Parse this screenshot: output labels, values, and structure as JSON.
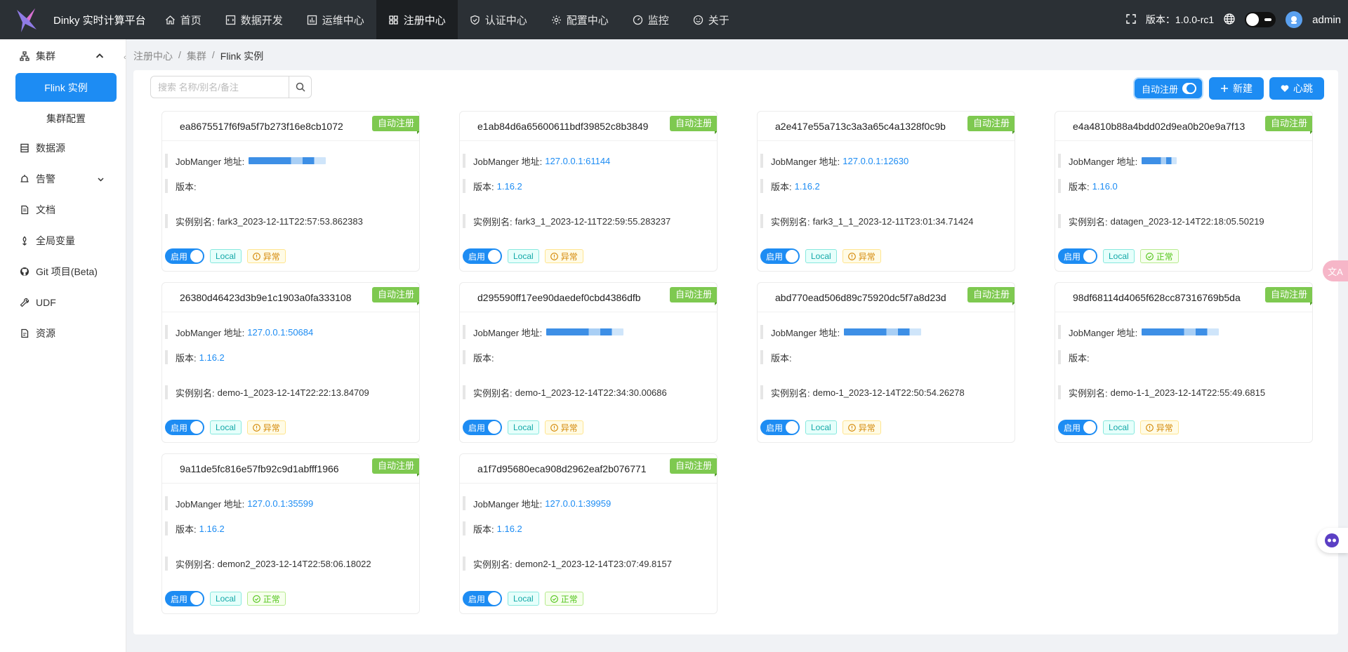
{
  "app": {
    "title": "Dinky 实时计算平台"
  },
  "nav": [
    {
      "label": "首页",
      "icon": "home-icon"
    },
    {
      "label": "数据开发",
      "icon": "code-icon"
    },
    {
      "label": "运维中心",
      "icon": "dashboard-icon"
    },
    {
      "label": "注册中心",
      "icon": "appstore-icon",
      "active": true
    },
    {
      "label": "认证中心",
      "icon": "shield-icon"
    },
    {
      "label": "配置中心",
      "icon": "settings-icon"
    },
    {
      "label": "监控",
      "icon": "gauge-icon"
    },
    {
      "label": "关于",
      "icon": "smile-icon"
    }
  ],
  "header": {
    "version": "版本：1.0.0-rc1",
    "user": "admin"
  },
  "sidebar": {
    "group": {
      "label": "集群",
      "expanded": true
    },
    "sub_items": [
      "Flink 实例",
      "集群配置"
    ],
    "items": [
      {
        "label": "数据源",
        "icon": "database-icon"
      },
      {
        "label": "告警",
        "icon": "alert-icon",
        "has_children": true
      },
      {
        "label": "文档",
        "icon": "document-icon"
      },
      {
        "label": "全局变量",
        "icon": "variable-icon"
      },
      {
        "label": "Git 项目(Beta)",
        "icon": "github-icon"
      },
      {
        "label": "UDF",
        "icon": "tool-icon"
      },
      {
        "label": "资源",
        "icon": "file-icon"
      }
    ]
  },
  "breadcrumb": [
    "注册中心",
    "集群",
    "Flink 实例"
  ],
  "toolbar": {
    "search_placeholder": "搜索 名称/别名/备注",
    "auto_register": "自动注册",
    "new": "新建",
    "heartbeat": "心跳"
  },
  "labels": {
    "jobmanager": "JobManger 地址:",
    "version": "版本:",
    "alias": "实例别名:",
    "enabled": "启用",
    "local": "Local",
    "auto_badge": "自动注册"
  },
  "cards": [
    {
      "id": "ea8675517f6f9a5f7b273f16e8cb1072",
      "address": "",
      "address_masked": true,
      "version": "",
      "alias": "fark3_2023-12-11T22:57:53.862383",
      "status": "异常",
      "status_type": "warn"
    },
    {
      "id": "e1ab84d6a65600611bdf39852c8b3849",
      "address": "127.0.0.1:61144",
      "version": "1.16.2",
      "alias": "fark3_1_2023-12-11T22:59:55.283237",
      "status": "异常",
      "status_type": "warn"
    },
    {
      "id": "a2e417e55a713c3a3a65c4a1328f0c9b",
      "address": "127.0.0.1:12630",
      "version": "1.16.2",
      "alias": "fark3_1_1_2023-12-11T23:01:34.71424",
      "status": "异常",
      "status_type": "warn"
    },
    {
      "id": "e4a4810b88a4bdd02d9ea0b20e9a7f13",
      "address": "",
      "address_masked": true,
      "version": "1.16.0",
      "alias": "datagen_2023-12-14T22:18:05.50219",
      "status": "正常",
      "status_type": "ok"
    },
    {
      "id": "26380d46423d3b9e1c1903a0fa333108",
      "address": "127.0.0.1:50684",
      "version": "1.16.2",
      "alias": "demo-1_2023-12-14T22:22:13.84709",
      "status": "异常",
      "status_type": "warn"
    },
    {
      "id": "d295590ff17ee90daedef0cbd4386dfb",
      "address": "",
      "address_masked": true,
      "version": "",
      "alias": "demo-1_2023-12-14T22:34:30.00686",
      "status": "异常",
      "status_type": "warn"
    },
    {
      "id": "abd770ead506d89c75920dc5f7a8d23d",
      "address": "",
      "address_masked": true,
      "version": "",
      "alias": "demo-1_2023-12-14T22:50:54.26278",
      "status": "异常",
      "status_type": "warn"
    },
    {
      "id": "98df68114d4065f628cc87316769b5da",
      "address": "",
      "address_masked": true,
      "version": "",
      "alias": "demo-1-1_2023-12-14T22:55:49.6815",
      "status": "异常",
      "status_type": "warn"
    },
    {
      "id": "9a11de5fc816e57fb92c9d1abfff1966",
      "address": "127.0.0.1:35599",
      "version": "1.16.2",
      "alias": "demon2_2023-12-14T22:58:06.18022",
      "status": "正常",
      "status_type": "ok"
    },
    {
      "id": "a1f7d95680eca908d2962eaf2b076771",
      "address": "127.0.0.1:39959",
      "version": "1.16.2",
      "alias": "demon2-1_2023-12-14T23:07:49.8157",
      "status": "正常",
      "status_type": "ok"
    }
  ],
  "floats": {
    "translate": "文A"
  }
}
